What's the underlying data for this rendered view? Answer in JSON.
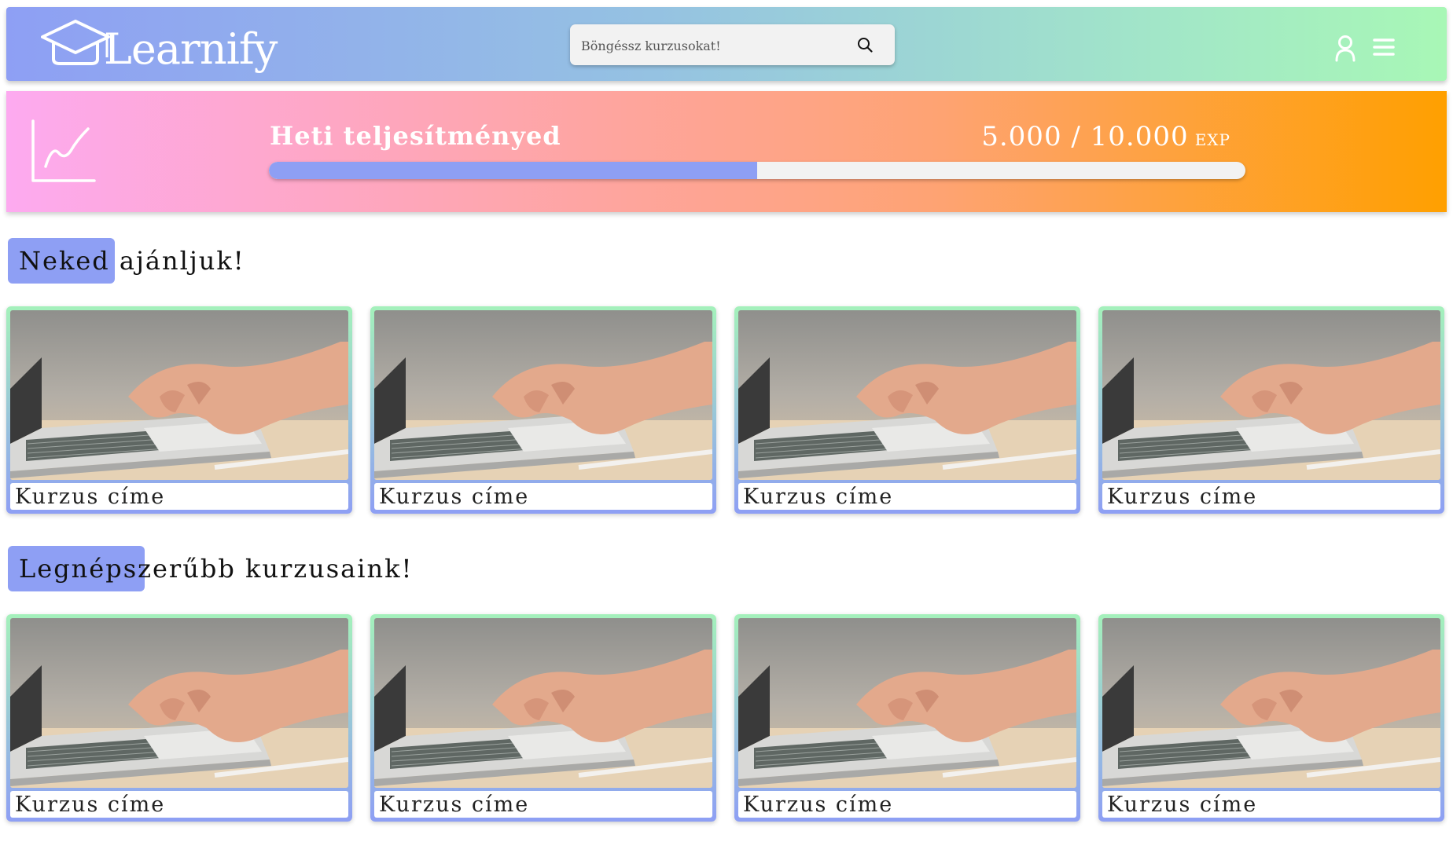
{
  "header": {
    "logo_text": "Learnify",
    "search_placeholder": "Böngéssz kurzusokat!"
  },
  "progress": {
    "title": "Heti teljesítményed",
    "value_text": "5.000 / 10.000",
    "unit": "EXP",
    "current": 5000,
    "max": 10000
  },
  "sections": [
    {
      "title": "Neked ajánljuk!",
      "cards": [
        {
          "title": "Kurzus címe"
        },
        {
          "title": "Kurzus címe"
        },
        {
          "title": "Kurzus címe"
        },
        {
          "title": "Kurzus címe"
        }
      ]
    },
    {
      "title": "Legnépszerűbb kurzusaink!",
      "cards": [
        {
          "title": "Kurzus címe"
        },
        {
          "title": "Kurzus címe"
        },
        {
          "title": "Kurzus címe"
        },
        {
          "title": "Kurzus címe"
        }
      ]
    }
  ],
  "icons": [
    "graduation-cap-icon",
    "search-icon",
    "user-icon",
    "menu-icon",
    "trend-chart-icon"
  ],
  "colors": {
    "accent": "#8e9ff4",
    "header_gradient_end": "#a8f7b6",
    "banner_gradient_start": "#fdaaf0",
    "banner_gradient_end": "#ffa000"
  }
}
